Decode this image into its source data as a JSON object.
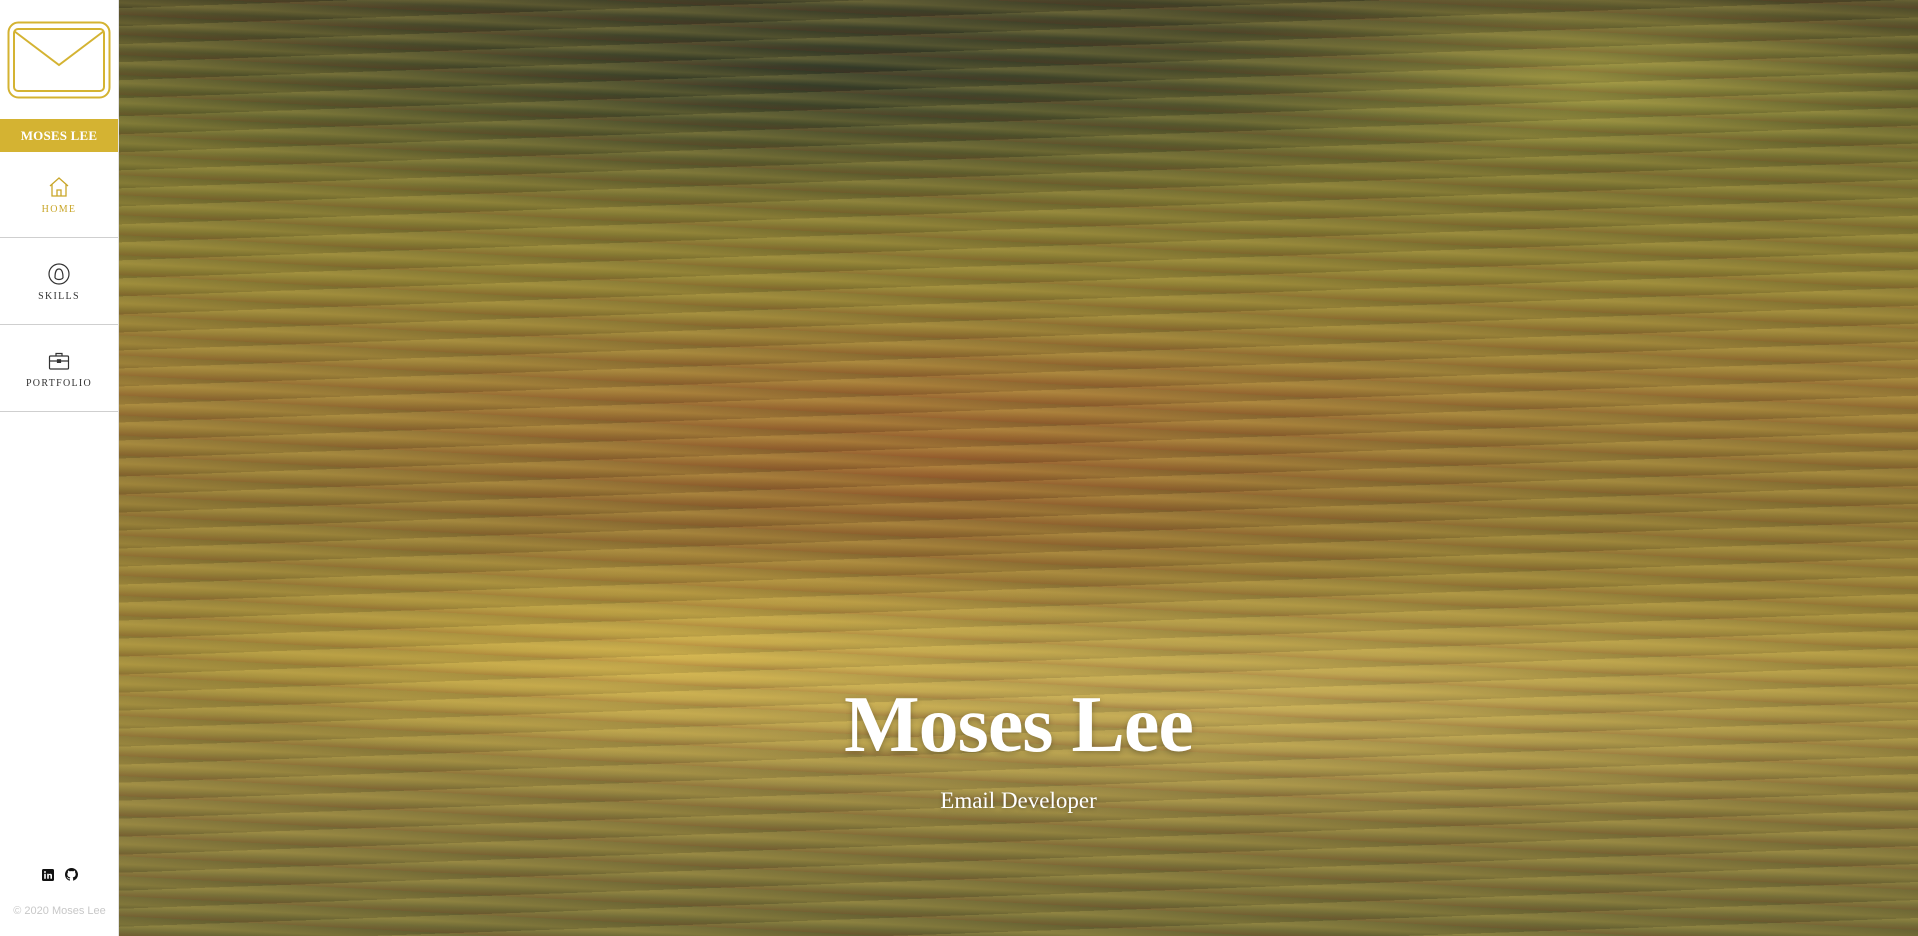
{
  "colors": {
    "accent": "#d4b332",
    "nav_text": "#333333",
    "active_nav": "#c9a628",
    "copyright": "#c8c8c8"
  },
  "sidebar": {
    "logo_icon": "envelope-icon",
    "name": "MOSES LEE",
    "items": [
      {
        "label": "HOME",
        "icon": "home-icon",
        "active": true
      },
      {
        "label": "SKILLS",
        "icon": "head-icon",
        "active": false
      },
      {
        "label": "PORTFOLIO",
        "icon": "briefcase-icon",
        "active": false
      }
    ],
    "social": [
      {
        "icon": "linkedin-icon"
      },
      {
        "icon": "github-icon"
      }
    ],
    "copyright": "© 2020 Moses Lee"
  },
  "hero": {
    "title": "Moses Lee",
    "subtitle": "Email Developer"
  }
}
